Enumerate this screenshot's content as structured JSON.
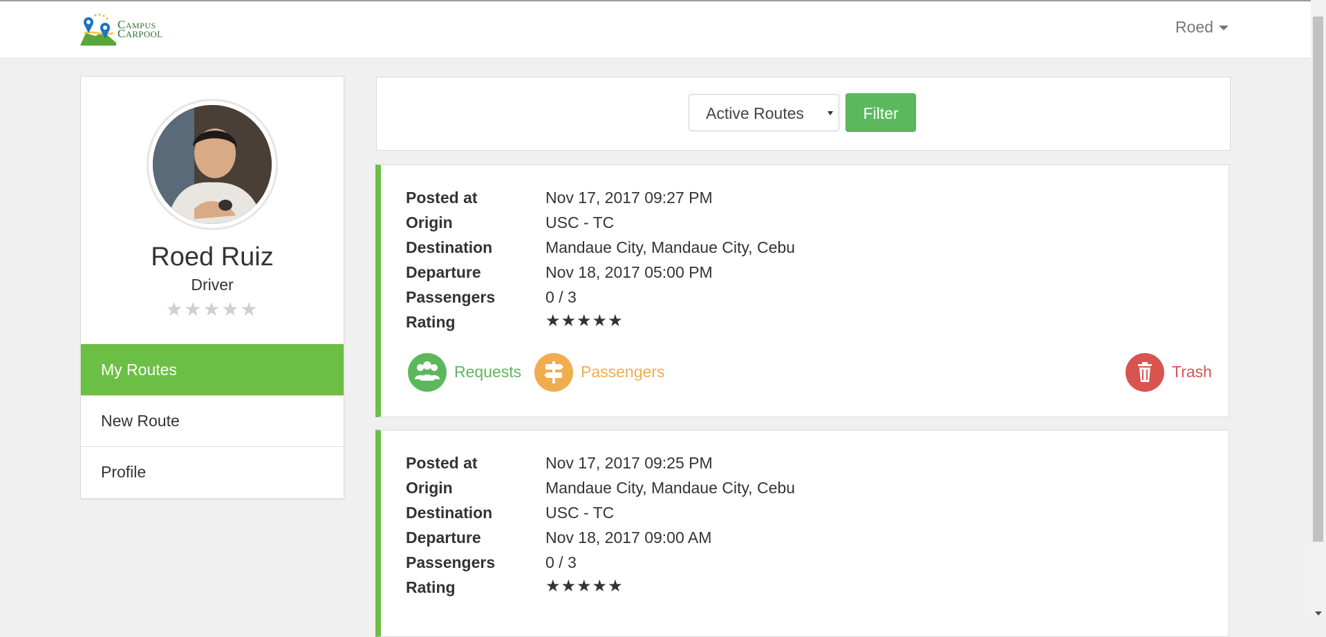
{
  "brand": {
    "line1": "AMPUS",
    "line2": "ARPOOL",
    "initial1": "C",
    "initial2": "C"
  },
  "user_menu": {
    "label": "Roed"
  },
  "profile": {
    "name": "Roed Ruiz",
    "role": "Driver",
    "stars": "★★★★★",
    "rating_value": 0
  },
  "sidebar": {
    "items": [
      {
        "label": "My Routes",
        "active": true
      },
      {
        "label": "New Route",
        "active": false
      },
      {
        "label": "Profile",
        "active": false
      }
    ]
  },
  "filter": {
    "selected": "Active Routes",
    "button": "Filter"
  },
  "labels": {
    "posted_at": "Posted at",
    "origin": "Origin",
    "destination": "Destination",
    "departure": "Departure",
    "passengers": "Passengers",
    "rating": "Rating"
  },
  "actions": {
    "requests": "Requests",
    "passengers": "Passengers",
    "trash": "Trash"
  },
  "routes": [
    {
      "posted_at": "Nov 17, 2017 09:27 PM",
      "origin": "USC - TC",
      "destination": "Mandaue City, Mandaue City, Cebu",
      "departure": "Nov 18, 2017 05:00 PM",
      "passengers": "0 / 3",
      "rating": "★★★★★"
    },
    {
      "posted_at": "Nov 17, 2017 09:25 PM",
      "origin": "Mandaue City, Mandaue City, Cebu",
      "destination": "USC - TC",
      "departure": "Nov 18, 2017 09:00 AM",
      "passengers": "0 / 3",
      "rating": "★★★★★"
    }
  ],
  "colors": {
    "accent_green": "#6cbf45",
    "success": "#5cb85c",
    "warning": "#f0ad4e",
    "danger": "#d9534f"
  }
}
